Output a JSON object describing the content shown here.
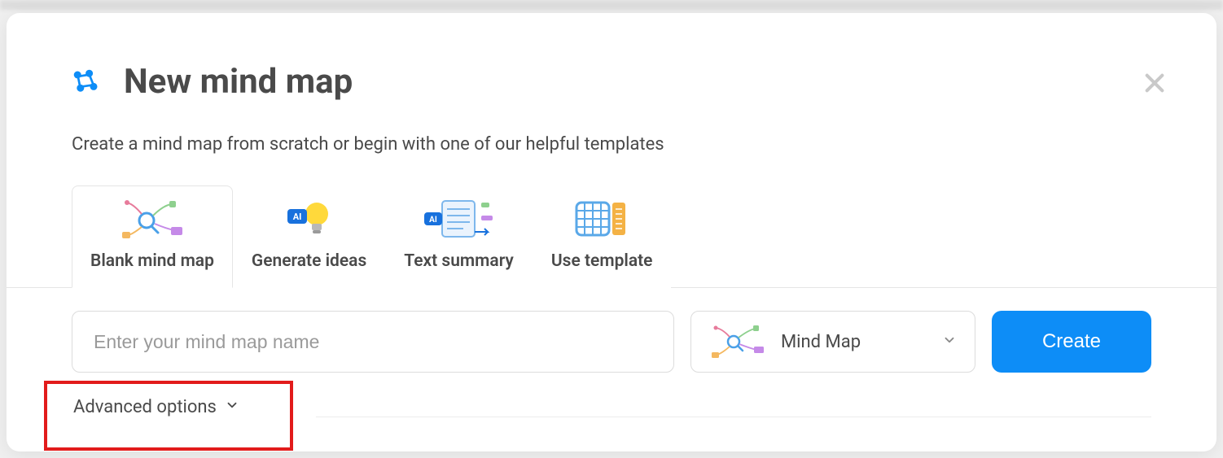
{
  "title": "New mind map",
  "subtitle": "Create a mind map from scratch or begin with one of our helpful templates",
  "tabs": [
    {
      "label": "Blank mind map"
    },
    {
      "label": "Generate ideas"
    },
    {
      "label": "Text summary"
    },
    {
      "label": "Use template"
    }
  ],
  "name_input": {
    "placeholder": "Enter your mind map name",
    "value": ""
  },
  "type_select": {
    "selected": "Mind Map"
  },
  "create_label": "Create",
  "advanced_label": "Advanced options",
  "colors": {
    "primary": "#0d8df7",
    "highlight": "#e21b1b"
  }
}
